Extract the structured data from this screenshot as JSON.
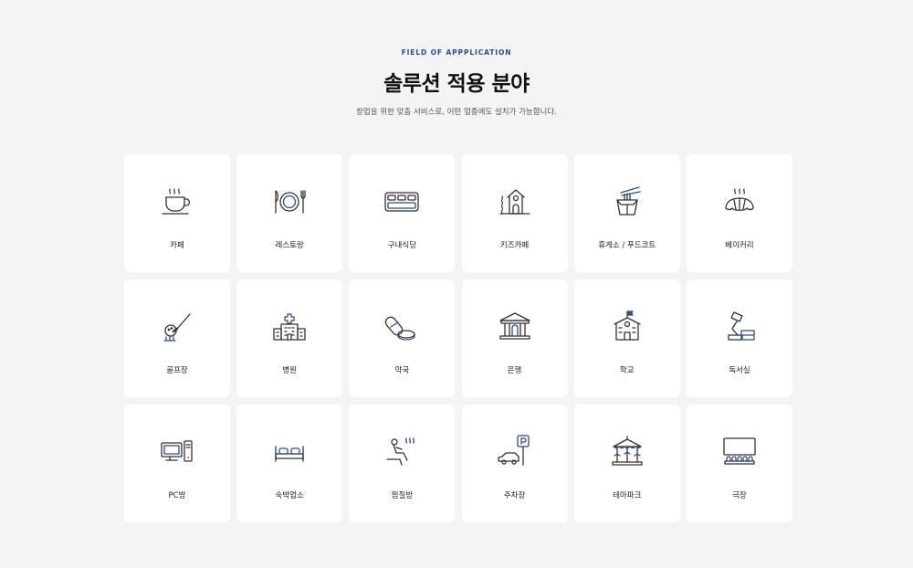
{
  "header": {
    "eyebrow": "FIELD OF APPPLICATION",
    "title": "솔루션 적용 분야",
    "subtitle": "창업을 위한 맞춤 서비스로, 어떤 업종에도 설치가 가능합니다."
  },
  "colors": {
    "line": "#333333",
    "accent": "#2f4a8a",
    "card": "#ffffff",
    "background": "#f4f4f4"
  },
  "items": [
    {
      "label": "카페",
      "icon": "coffee-cup-icon"
    },
    {
      "label": "레스토랑",
      "icon": "plate-cutlery-icon"
    },
    {
      "label": "구내식당",
      "icon": "meal-tray-icon"
    },
    {
      "label": "키즈카페",
      "icon": "kids-house-icon"
    },
    {
      "label": "휴게소 / 푸드코트",
      "icon": "noodle-box-icon"
    },
    {
      "label": "베이커리",
      "icon": "croissant-icon"
    },
    {
      "label": "골프장",
      "icon": "golf-club-icon"
    },
    {
      "label": "병원",
      "icon": "hospital-icon"
    },
    {
      "label": "약국",
      "icon": "pill-icon"
    },
    {
      "label": "은행",
      "icon": "bank-icon"
    },
    {
      "label": "학교",
      "icon": "school-icon"
    },
    {
      "label": "독서실",
      "icon": "desk-lamp-icon"
    },
    {
      "label": "PC방",
      "icon": "computer-icon"
    },
    {
      "label": "숙박업소",
      "icon": "bed-icon"
    },
    {
      "label": "찜질방",
      "icon": "sauna-icon"
    },
    {
      "label": "주차장",
      "icon": "parking-car-icon"
    },
    {
      "label": "테마파크",
      "icon": "carousel-icon"
    },
    {
      "label": "극장",
      "icon": "theater-icon"
    }
  ]
}
